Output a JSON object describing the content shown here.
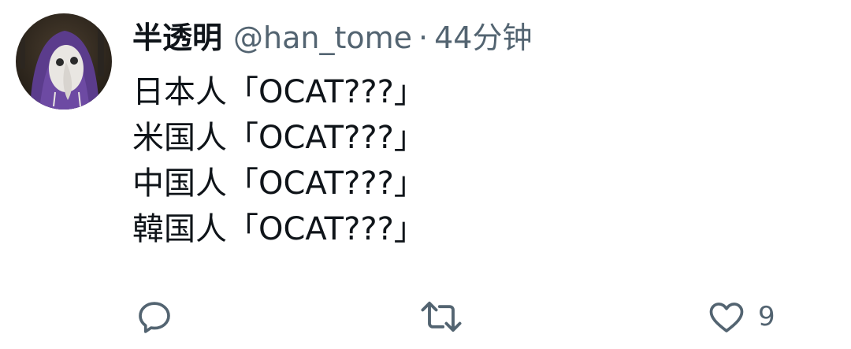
{
  "tweet": {
    "author": {
      "display_name": "半透明",
      "handle": "@han_tome"
    },
    "separator": "·",
    "time": "44分钟",
    "body_lines": [
      "日本人「OCAT???」",
      "米国人「OCAT???」",
      "中国人「OCAT???」",
      "韓国人「OCAT???」"
    ],
    "actions": {
      "reply_icon": "reply-icon",
      "retweet_icon": "retweet-icon",
      "like_icon": "heart-icon",
      "like_count": "9"
    }
  },
  "colors": {
    "text_primary": "#0f1419",
    "text_secondary": "#536471",
    "background": "#ffffff"
  }
}
